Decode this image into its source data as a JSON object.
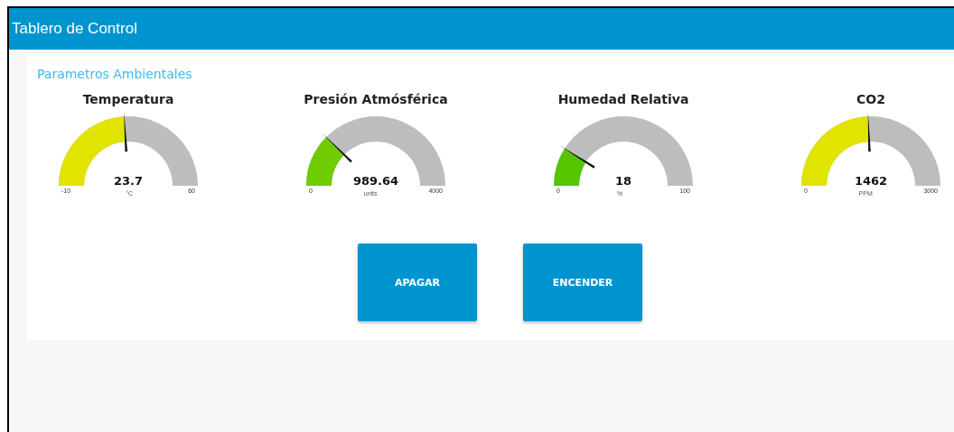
{
  "header": {
    "title": "Tablero de Control"
  },
  "group": {
    "title": "Parametros Ambientales",
    "gauges": [
      {
        "title": "Temperatura",
        "value": "23.7",
        "unit": "°C",
        "min": "-10",
        "max": "60",
        "color": "#e0e400"
      },
      {
        "title": "Presión Atmósférica",
        "value": "989.64",
        "unit": "units",
        "min": "0",
        "max": "4000",
        "color": "#6ecc00"
      },
      {
        "title": "Humedad Relativa",
        "value": "18",
        "unit": "%",
        "min": "0",
        "max": "100",
        "color": "#55c500"
      },
      {
        "title": "CO2",
        "value": "1462",
        "unit": "PPM",
        "min": "0",
        "max": "3000",
        "color": "#e0e400"
      }
    ]
  },
  "buttons": [
    {
      "label": "APAGAR"
    },
    {
      "label": "ENCENDER"
    }
  ]
}
